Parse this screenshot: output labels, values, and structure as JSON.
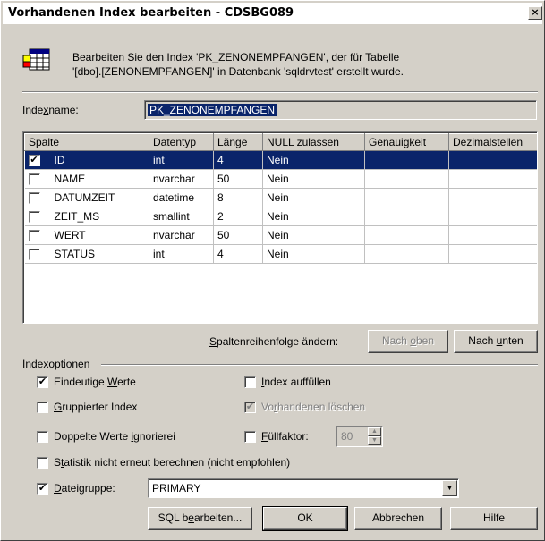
{
  "window": {
    "title": "Vorhandenen Index bearbeiten - CDSBG089",
    "close_glyph": "×"
  },
  "description": {
    "line1": "Bearbeiten Sie den Index 'PK_ZENONEMPFANGEN', der für Tabelle",
    "line2": "'[dbo].[ZENONEMPFANGEN]' in Datenbank 'sqldrvtest' erstellt wurde."
  },
  "index_name": {
    "label_pre": "Inde",
    "label_access": "x",
    "label_post": "name:",
    "value": "PK_ZENONEMPFANGEN"
  },
  "columns_table": {
    "headers": [
      "Spalte",
      "Datentyp",
      "Länge",
      "NULL zulassen",
      "Genauigkeit",
      "Dezimalstellen"
    ],
    "rows": [
      {
        "checked": true,
        "check": "✔",
        "spalte": "ID",
        "datentyp": "int",
        "laenge": "4",
        "null": "Nein",
        "selected": true
      },
      {
        "checked": false,
        "check": "",
        "spalte": "NAME",
        "datentyp": "nvarchar",
        "laenge": "50",
        "null": "Nein",
        "selected": false
      },
      {
        "checked": false,
        "check": "",
        "spalte": "DATUMZEIT",
        "datentyp": "datetime",
        "laenge": "8",
        "null": "Nein",
        "selected": false
      },
      {
        "checked": false,
        "check": "",
        "spalte": "ZEIT_MS",
        "datentyp": "smallint",
        "laenge": "2",
        "null": "Nein",
        "selected": false
      },
      {
        "checked": false,
        "check": "",
        "spalte": "WERT",
        "datentyp": "nvarchar",
        "laenge": "50",
        "null": "Nein",
        "selected": false
      },
      {
        "checked": false,
        "check": "",
        "spalte": "STATUS",
        "datentyp": "int",
        "laenge": "4",
        "null": "Nein",
        "selected": false
      }
    ]
  },
  "reorder": {
    "label_access": "S",
    "label_rest": "paltenreihenfolge ändern:",
    "up_pre": "Nach ",
    "up_access": "o",
    "up_post": "ben",
    "down_pre": "Nach ",
    "down_access": "u",
    "down_post": "nten"
  },
  "options": {
    "group_label": "Indexoptionen",
    "unique": {
      "checked": true,
      "check": "✔",
      "pre": "Eindeutige ",
      "access": "W",
      "post": "erte"
    },
    "clustered": {
      "checked": false,
      "check": "",
      "pre": "",
      "access": "G",
      "post": "ruppierter Index"
    },
    "ignore_dup": {
      "checked": false,
      "check": "",
      "pre": "Doppelte Werte ",
      "access": "i",
      "post": "gnorierei"
    },
    "no_recompute": {
      "checked": false,
      "check": "",
      "pre": "S",
      "access": "t",
      "post": "atistik nicht erneut berechnen (nicht empfohlen)"
    },
    "pad_index": {
      "checked": false,
      "check": "",
      "pre": "",
      "access": "I",
      "post": "ndex auffüllen"
    },
    "drop_existing": {
      "checked": true,
      "check": "✔",
      "disabled": true,
      "pre": "Vo",
      "access": "r",
      "post": "handenen löschen"
    },
    "fill_factor": {
      "checked": false,
      "check": "",
      "pre": "",
      "access": "F",
      "post": "üllfaktor:",
      "value": "80",
      "up": "▲",
      "down": "▼"
    },
    "filegroup": {
      "checked": true,
      "check": "✔",
      "pre": "",
      "access": "D",
      "post": "ateigruppe:",
      "value": "PRIMARY",
      "drop_glyph": "▼"
    }
  },
  "buttons": {
    "sql_pre": "SQL b",
    "sql_access": "e",
    "sql_post": "arbeiten...",
    "ok": "OK",
    "cancel": "Abbrechen",
    "help": "Hilfe"
  },
  "colors": {
    "face": "#d4d0c8",
    "highlight": "#0a246a"
  }
}
